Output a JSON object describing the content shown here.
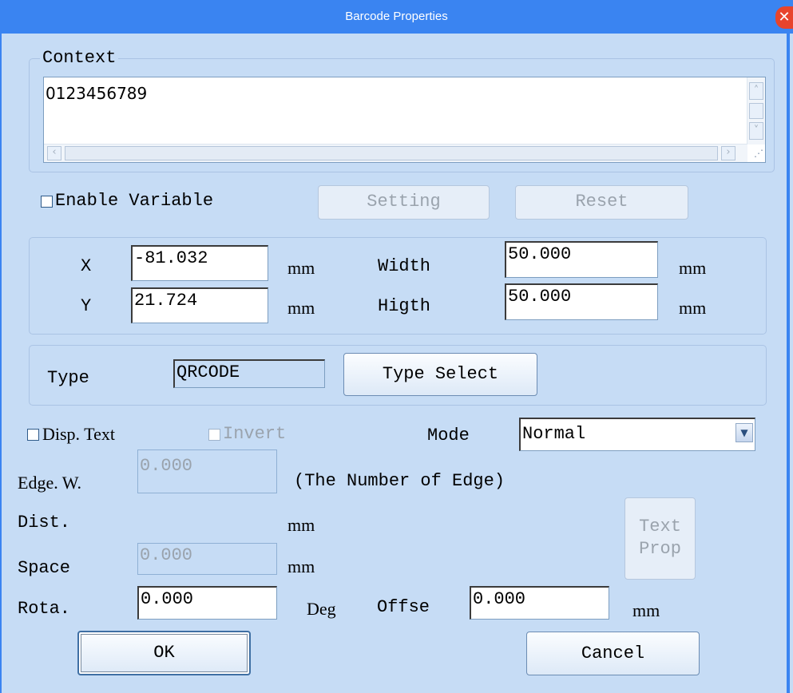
{
  "window": {
    "title": "Barcode Properties"
  },
  "context": {
    "legend": "Context",
    "value": "0123456789"
  },
  "variable": {
    "enable_label": "Enable Variable",
    "setting_label": "Setting",
    "reset_label": "Reset"
  },
  "position": {
    "x_label": "X",
    "x_value": "-81.032",
    "x_unit": "mm",
    "y_label": "Y",
    "y_value": "21.724",
    "y_unit": "mm",
    "width_label": "Width",
    "width_value": "50.000",
    "width_unit": "mm",
    "height_label": "Higth",
    "height_value": "50.000",
    "height_unit": "mm"
  },
  "type": {
    "label": "Type",
    "value": "QRCODE",
    "select_label": "Type Select"
  },
  "display": {
    "disp_text_label": "Disp. Text",
    "invert_label": "Invert",
    "mode_label": "Mode",
    "mode_value": "Normal",
    "edge_label": "Edge. W.",
    "edge_value": "0.000",
    "edge_note": "(The Number of Edge)",
    "dist_label": "Dist.",
    "dist_unit": "mm",
    "space_label": "Space",
    "space_value": "0.000",
    "space_unit": "mm",
    "text_prop_line1": "Text",
    "text_prop_line2": "Prop",
    "rota_label": "Rota.",
    "rota_value": "0.000",
    "rota_unit": "Deg",
    "offset_label": "Offse",
    "offset_value": "0.000",
    "offset_unit": "mm"
  },
  "actions": {
    "ok_label": "OK",
    "cancel_label": "Cancel"
  },
  "icons": {
    "close": "close-icon",
    "dropdown": "chevron-down-icon"
  },
  "colors": {
    "titlebar": "#3a84f1",
    "background": "#c6dcf5",
    "close": "#e8442c"
  }
}
